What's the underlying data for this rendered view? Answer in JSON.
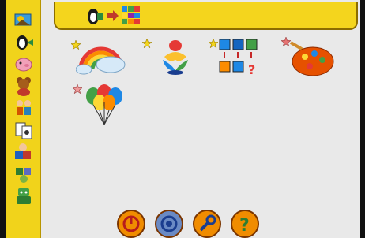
{
  "app": {
    "title": ""
  },
  "sidebar": {
    "items": [
      {
        "name": "sidebar-item-picture-matching"
      },
      {
        "name": "sidebar-item-animals"
      },
      {
        "name": "sidebar-item-farm"
      },
      {
        "name": "sidebar-item-toys"
      },
      {
        "name": "sidebar-item-activity"
      },
      {
        "name": "sidebar-item-memory"
      },
      {
        "name": "sidebar-item-blocks"
      },
      {
        "name": "sidebar-item-puzzle"
      },
      {
        "name": "sidebar-item-robot"
      }
    ]
  },
  "header": {
    "breadcrumb": {
      "from_icon": "penguin-icon",
      "to_icon": "grid-icon"
    }
  },
  "main": {
    "activities": [
      {
        "name": "rainbow-activity",
        "icon": "rainbow-icon",
        "starred": true
      },
      {
        "name": "bird-activity",
        "icon": "bird-icon",
        "starred": true
      },
      {
        "name": "sequence-activity",
        "icon": "color-sequence-icon",
        "starred": true
      },
      {
        "name": "paint-activity",
        "icon": "palette-icon",
        "starred": true
      },
      {
        "name": "balloons-activity",
        "icon": "balloons-icon",
        "starred": true
      }
    ]
  },
  "bottombar": {
    "buttons": [
      {
        "name": "quit-button",
        "icon": "power-icon"
      },
      {
        "name": "about-button",
        "icon": "about-icon"
      },
      {
        "name": "settings-button",
        "icon": "wrench-icon"
      },
      {
        "name": "help-button",
        "icon": "question-icon"
      }
    ]
  },
  "colors": {
    "accent": "#f1d31b",
    "background": "#e9e9e9",
    "button": "#f08c00"
  }
}
